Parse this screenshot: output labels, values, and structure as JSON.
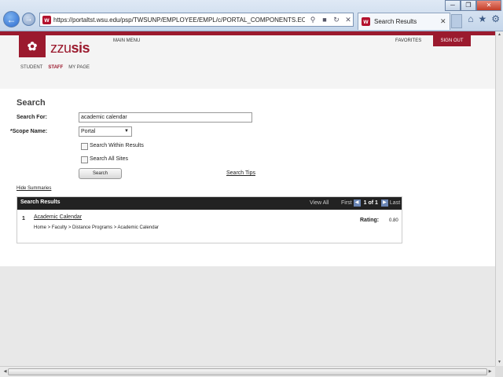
{
  "browser": {
    "url": "https://portaltst.wsu.edu/psp/TWSUNP/EMPLOYEE/EMPL/c/PORTAL_COMPONENTS.EO_I",
    "tab_title": "Search Results",
    "tab_close": "✕",
    "favicon": "wsu-favicon",
    "window_buttons": [
      "─",
      "❐",
      "✕"
    ],
    "toolbar_icons": [
      "home-icon",
      "star-icon",
      "gear-icon"
    ],
    "address_icons": [
      "search-icon",
      "lock-icon",
      "refresh-icon",
      "close-icon"
    ]
  },
  "header": {
    "logo_zzu": "zzu",
    "logo_sis": "sis",
    "main_menu": "MAIN MENU",
    "favorites": "FAVORITES",
    "sign_out": "SIGN OUT",
    "nav_tabs": [
      "STUDENT",
      "STAFF",
      "MY PAGE"
    ]
  },
  "search": {
    "title": "Search",
    "search_for_label": "Search For:",
    "search_for_value": "academic calendar",
    "scope_label": "*Scope Name:",
    "scope_value": "Portal",
    "within_results_label": "Search Within Results",
    "all_sites_label": "Search All Sites",
    "search_button": "Search",
    "search_tips": "Search Tips",
    "hide_summaries": "Hide Summaries"
  },
  "results": {
    "header": "Search Results",
    "view_all": "View All",
    "first": "First",
    "count": "1 of 1",
    "last": "Last",
    "items": [
      {
        "num": "1",
        "title": "Academic Calendar",
        "path": "Home > Faculty > Distance Programs > Academic Calendar",
        "rating_label": "Rating:",
        "rating": "0.80"
      }
    ]
  },
  "colors": {
    "brand": "#9b1a2e",
    "results_header": "#222222"
  }
}
